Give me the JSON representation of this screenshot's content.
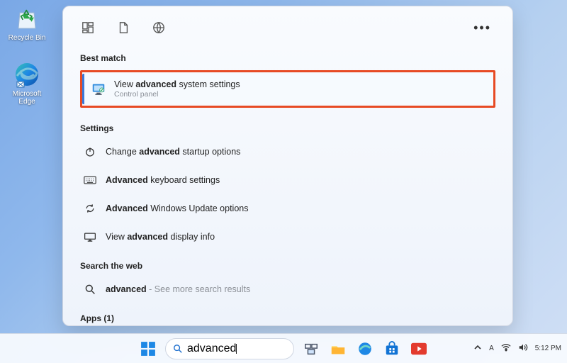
{
  "desktop": {
    "icons": [
      {
        "label": "Recycle Bin",
        "name": "recycle-bin"
      },
      {
        "label": "Microsoft\nEdge",
        "name": "microsoft-edge"
      }
    ]
  },
  "search_panel": {
    "sections": {
      "best_match": "Best match",
      "settings": "Settings",
      "search_web": "Search the web",
      "apps": "Apps (1)"
    },
    "best_match": {
      "pre": "View ",
      "bold": "advanced",
      "post": " system settings",
      "subtitle": "Control panel"
    },
    "settings_items": [
      {
        "pre": "Change ",
        "bold": "advanced",
        "post": " startup options",
        "icon": "power"
      },
      {
        "pre": "",
        "bold": "Advanced",
        "post": " keyboard settings",
        "icon": "keyboard"
      },
      {
        "pre": "",
        "bold": "Advanced",
        "post": " Windows Update options",
        "icon": "update"
      },
      {
        "pre": "View ",
        "bold": "advanced",
        "post": " display info",
        "icon": "display"
      }
    ],
    "web_item": {
      "bold": "advanced",
      "suffix": " - See more search results"
    }
  },
  "taskbar": {
    "search_value": "advanced",
    "time": "5:12 PM"
  }
}
